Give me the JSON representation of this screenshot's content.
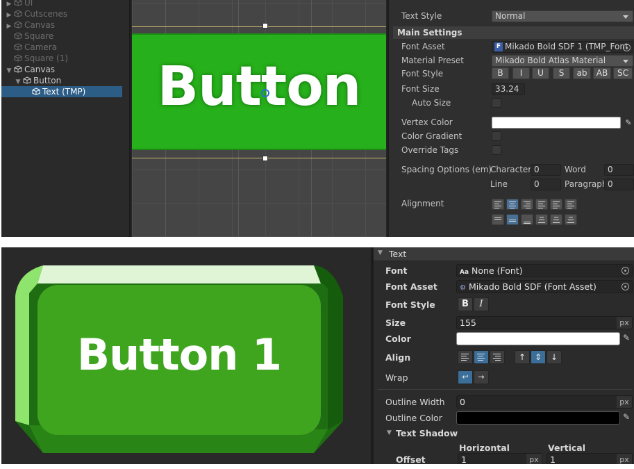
{
  "hierarchy": {
    "items": [
      {
        "label": "UI",
        "depth": 1,
        "arrow": "▶",
        "dim": true
      },
      {
        "label": "Cutscenes",
        "depth": 1,
        "arrow": "▶",
        "dim": true
      },
      {
        "label": "Canvas",
        "depth": 1,
        "arrow": "▶",
        "dim": true
      },
      {
        "label": "Square",
        "depth": 1,
        "arrow": "",
        "dim": true
      },
      {
        "label": "Camera",
        "depth": 1,
        "arrow": "",
        "dim": true
      },
      {
        "label": "Square (1)",
        "depth": 1,
        "arrow": "",
        "dim": true
      },
      {
        "label": "Canvas",
        "depth": 1,
        "arrow": "▼",
        "dim": false
      },
      {
        "label": "Button",
        "depth": 2,
        "arrow": "▼",
        "dim": false
      },
      {
        "label": "Text (TMP)",
        "depth": 3,
        "arrow": "",
        "dim": false,
        "selected": true
      }
    ]
  },
  "scene": {
    "button_text": "Button",
    "button_color": "#26b01b"
  },
  "tmp_inspector": {
    "text_style_label": "Text Style",
    "text_style_value": "Normal",
    "main_settings": "Main Settings",
    "font_asset_label": "Font Asset",
    "font_asset_value": "Mikado Bold SDF 1 (TMP_Font",
    "material_preset_label": "Material Preset",
    "material_preset_value": "Mikado Bold Atlas Material",
    "font_style_label": "Font Style",
    "font_style_buttons": [
      "B",
      "I",
      "U",
      "S",
      "ab",
      "AB",
      "SC"
    ],
    "font_size_label": "Font Size",
    "font_size_value": "33.24",
    "auto_size_label": "Auto Size",
    "vertex_color_label": "Vertex Color",
    "color_gradient_label": "Color Gradient",
    "override_tags_label": "Override Tags",
    "spacing_label": "Spacing Options (em)",
    "character_label": "Character",
    "character_value": "0",
    "word_label": "Word",
    "word_value": "0",
    "line_label": "Line",
    "line_value": "0",
    "paragraph_label": "Paragraph",
    "paragraph_value": "0",
    "alignment_label": "Alignment"
  },
  "preview": {
    "button_text": "Button 1"
  },
  "uitk_inspector": {
    "section_title": "Text",
    "font_label": "Font",
    "font_value": "None (Font)",
    "font_prefix": "Aa",
    "font_asset_label": "Font Asset",
    "font_asset_value": "Mikado Bold SDF (Font Asset)",
    "font_style_label": "Font Style",
    "font_style_b": "B",
    "font_style_i": "I",
    "size_label": "Size",
    "size_value": "155",
    "size_unit": "px",
    "color_label": "Color",
    "align_label": "Align",
    "wrap_label": "Wrap",
    "outline_width_label": "Outline Width",
    "outline_width_value": "0",
    "outline_width_unit": "px",
    "outline_color_label": "Outline Color",
    "text_shadow_label": "Text Shadow",
    "horizontal_label": "Horizontal",
    "vertical_label": "Vertical",
    "offset_label": "Offset",
    "offset_h_value": "1",
    "offset_h_unit": "px",
    "offset_v_value": "1",
    "offset_v_unit": "px"
  }
}
